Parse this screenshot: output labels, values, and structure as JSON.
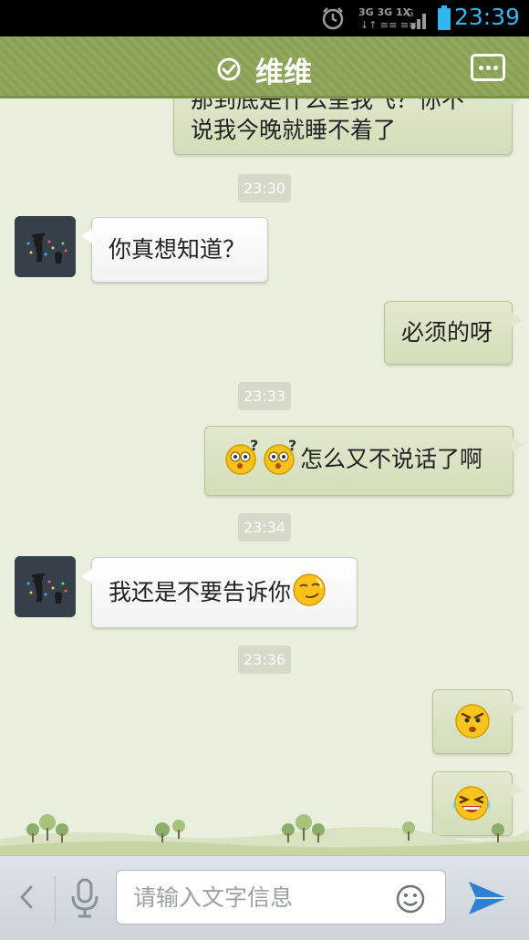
{
  "status_bar": {
    "time": "23:39",
    "network": "3G",
    "icons": [
      "alarm-icon",
      "network-icon",
      "signal-icon",
      "battery-icon"
    ]
  },
  "header": {
    "title": "维维",
    "left_icon": "check-circle-icon",
    "right_icon": "more-icon"
  },
  "messages": [
    {
      "type": "text",
      "side": "out",
      "lines": [
        "那到底是什么呈我飞？你不",
        "说我今晚就睡不着了"
      ]
    },
    {
      "type": "time",
      "text": "23:30"
    },
    {
      "type": "text",
      "side": "in",
      "text": "你真想知道？"
    },
    {
      "type": "text",
      "side": "out",
      "text": "必须的呀"
    },
    {
      "type": "time",
      "text": "23:33"
    },
    {
      "type": "text",
      "side": "out",
      "emojis": [
        "confused-emoji",
        "confused-emoji"
      ],
      "text": "怎么又不说话了啊"
    },
    {
      "type": "time",
      "text": "23:34"
    },
    {
      "type": "text",
      "side": "in",
      "text": "我还是不要告诉你",
      "emoji": "smug-emoji"
    },
    {
      "type": "time",
      "text": "23:36"
    },
    {
      "type": "emoji",
      "side": "out",
      "emoji": "angry-emoji"
    },
    {
      "type": "emoji",
      "side": "out",
      "emoji": "laughing-emoji"
    }
  ],
  "input_bar": {
    "placeholder": "请输入文字信息",
    "icons": [
      "chevron-left-icon",
      "microphone-icon",
      "smiley-icon",
      "send-icon"
    ]
  },
  "colors": {
    "header": "#8ea558",
    "chat_background": "#e9efdd",
    "outgoing_bubble": "#d9e3c3",
    "incoming_bubble": "#ffffff",
    "time_badge": "#d4dac8",
    "clock": "#31b6f0",
    "send": "#2f7fd3"
  }
}
